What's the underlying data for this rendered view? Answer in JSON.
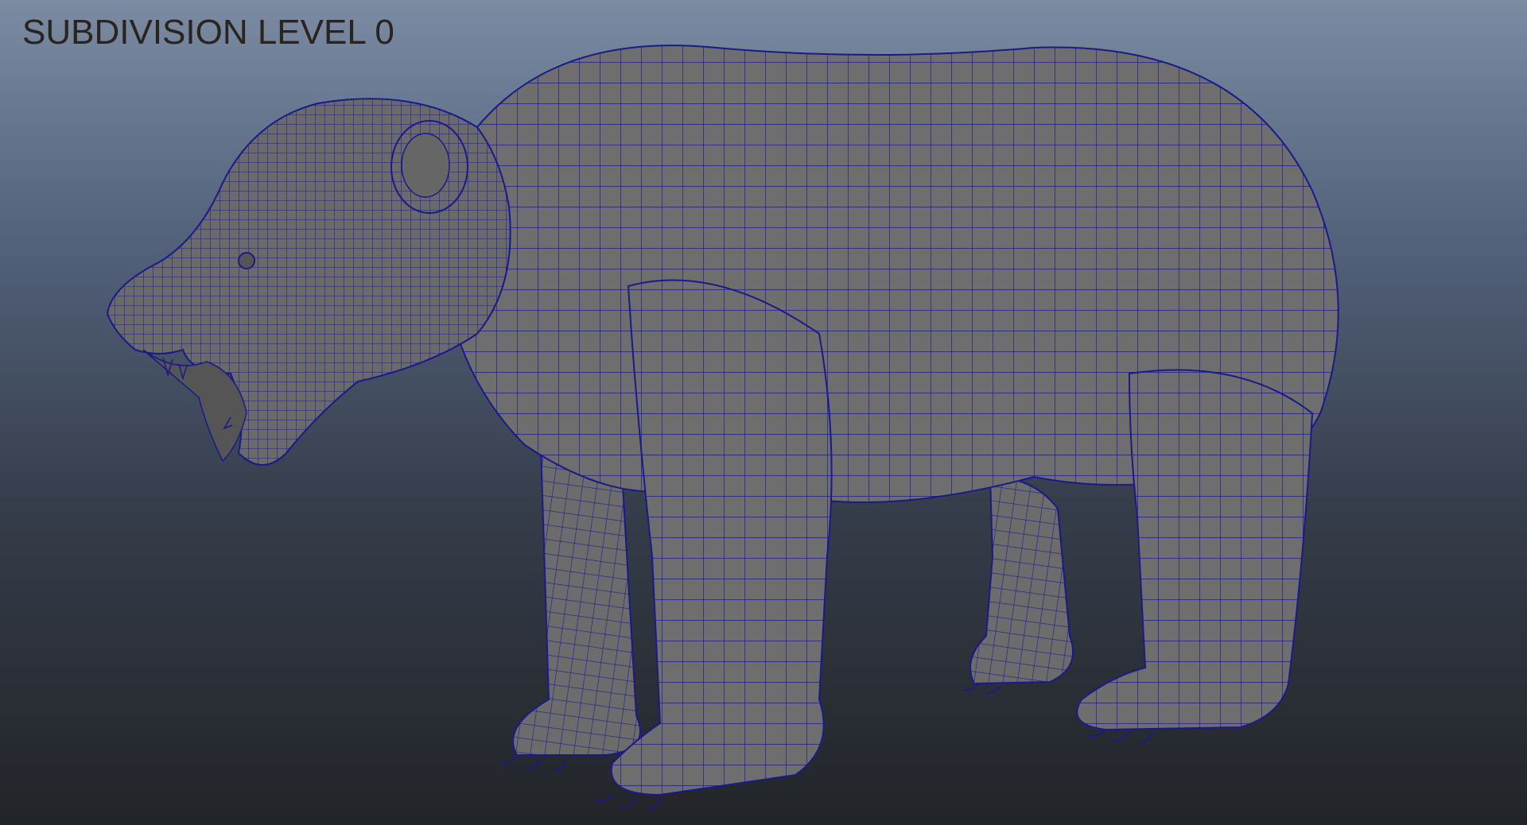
{
  "viewport": {
    "label": "SUBDIVISION LEVEL 0",
    "background_top": "#7a8ba2",
    "background_bottom": "#222428"
  },
  "model": {
    "subject": "bear-mesh",
    "surface_color": "#6e6e6e",
    "wire_color": "#1a1a88",
    "display_mode": "wireframe-on-shaded"
  }
}
